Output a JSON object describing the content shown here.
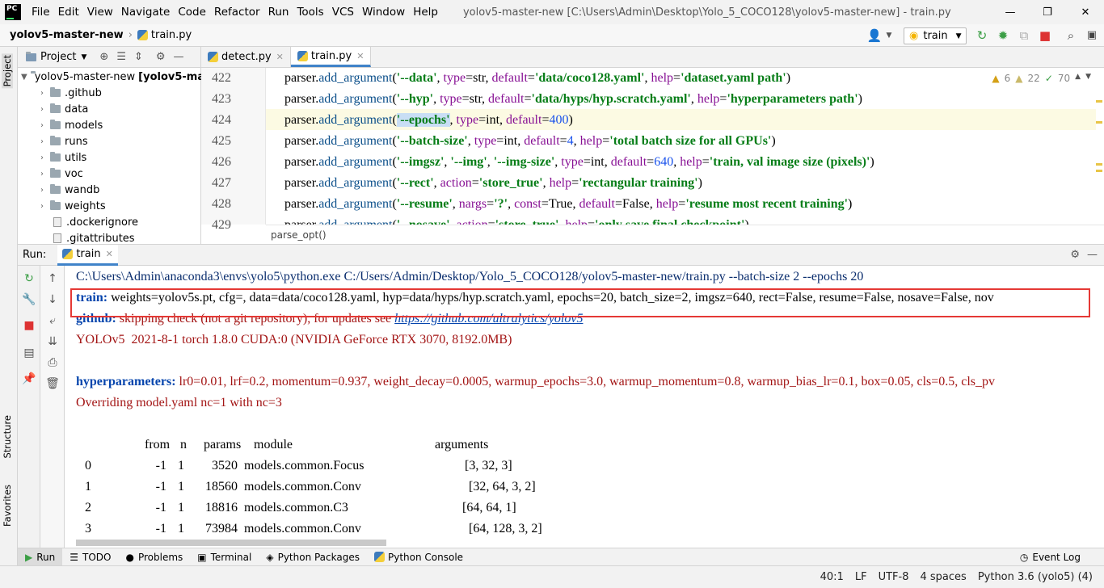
{
  "menu": [
    "File",
    "Edit",
    "View",
    "Navigate",
    "Code",
    "Refactor",
    "Run",
    "Tools",
    "VCS",
    "Window",
    "Help"
  ],
  "window_title": "yolov5-master-new [C:\\Users\\Admin\\Desktop\\Yolo_5_COCO128\\yolov5-master-new] - train.py",
  "app_logo": "PC",
  "navbar": {
    "project": "yolov5-master-new",
    "file": "train.py"
  },
  "run_config": "train",
  "sidebar_left": {
    "project": "Project",
    "structure": "Structure",
    "favorites": "Favorites"
  },
  "project_pane": {
    "title": "Project",
    "root": "yolov5-master-new",
    "root_suffix": "[yolov5-ma",
    "items": [
      {
        "label": ".github",
        "type": "folder"
      },
      {
        "label": "data",
        "type": "folder"
      },
      {
        "label": "models",
        "type": "folder"
      },
      {
        "label": "runs",
        "type": "folder"
      },
      {
        "label": "utils",
        "type": "folder"
      },
      {
        "label": "voc",
        "type": "folder"
      },
      {
        "label": "wandb",
        "type": "folder"
      },
      {
        "label": "weights",
        "type": "folder"
      },
      {
        "label": ".dockerignore",
        "type": "file"
      },
      {
        "label": ".gitattributes",
        "type": "file"
      }
    ]
  },
  "editor": {
    "tabs": [
      "detect.py",
      "train.py"
    ],
    "inspections": {
      "warnings": "6",
      "weak": "22",
      "typos": "70"
    },
    "breadcrumb": "parse_opt()",
    "line_numbers": [
      "422",
      "423",
      "424",
      "425",
      "426",
      "427",
      "428",
      "429"
    ],
    "lines": [
      [
        [
          "parser.",
          "n"
        ],
        [
          "add_argument",
          "fn"
        ],
        [
          "(",
          "n"
        ],
        [
          "'--data'",
          "s"
        ],
        [
          ", ",
          "n"
        ],
        [
          "type",
          "kw"
        ],
        [
          "=str, ",
          "n"
        ],
        [
          "default",
          "kw"
        ],
        [
          "=",
          "n"
        ],
        [
          "'data/coco128.yaml'",
          "s"
        ],
        [
          ", ",
          "n"
        ],
        [
          "help",
          "kw"
        ],
        [
          "=",
          "n"
        ],
        [
          "'dataset.yaml path'",
          "s"
        ],
        [
          ")",
          "n"
        ]
      ],
      [
        [
          "parser.",
          "n"
        ],
        [
          "add_argument",
          "fn"
        ],
        [
          "(",
          "n"
        ],
        [
          "'--hyp'",
          "s"
        ],
        [
          ", ",
          "n"
        ],
        [
          "type",
          "kw"
        ],
        [
          "=str, ",
          "n"
        ],
        [
          "default",
          "kw"
        ],
        [
          "=",
          "n"
        ],
        [
          "'data/hyps/hyp.scratch.yaml'",
          "s"
        ],
        [
          ", ",
          "n"
        ],
        [
          "help",
          "kw"
        ],
        [
          "=",
          "n"
        ],
        [
          "'hyperparameters path'",
          "s"
        ],
        [
          ")",
          "n"
        ]
      ],
      [
        [
          "parser.",
          "n"
        ],
        [
          "add_argument",
          "fn"
        ],
        [
          "(",
          "n"
        ],
        [
          "'--epochs'",
          "s"
        ],
        [
          ", ",
          "n"
        ],
        [
          "type",
          "kw"
        ],
        [
          "=int, ",
          "n"
        ],
        [
          "default",
          "kw"
        ],
        [
          "=",
          "n"
        ],
        [
          "400",
          "num"
        ],
        [
          ")",
          "n"
        ]
      ],
      [
        [
          "parser.",
          "n"
        ],
        [
          "add_argument",
          "fn"
        ],
        [
          "(",
          "n"
        ],
        [
          "'--batch-size'",
          "s"
        ],
        [
          ", ",
          "n"
        ],
        [
          "type",
          "kw"
        ],
        [
          "=int, ",
          "n"
        ],
        [
          "default",
          "kw"
        ],
        [
          "=",
          "n"
        ],
        [
          "4",
          "num"
        ],
        [
          ", ",
          "n"
        ],
        [
          "help",
          "kw"
        ],
        [
          "=",
          "n"
        ],
        [
          "'total batch size for all GPUs'",
          "s"
        ],
        [
          ")",
          "n"
        ]
      ],
      [
        [
          "parser.",
          "n"
        ],
        [
          "add_argument",
          "fn"
        ],
        [
          "(",
          "n"
        ],
        [
          "'--imgsz'",
          "s"
        ],
        [
          ", ",
          "n"
        ],
        [
          "'--img'",
          "s"
        ],
        [
          ", ",
          "n"
        ],
        [
          "'--img-size'",
          "s"
        ],
        [
          ", ",
          "n"
        ],
        [
          "type",
          "kw"
        ],
        [
          "=int, ",
          "n"
        ],
        [
          "default",
          "kw"
        ],
        [
          "=",
          "n"
        ],
        [
          "640",
          "num"
        ],
        [
          ", ",
          "n"
        ],
        [
          "help",
          "kw"
        ],
        [
          "=",
          "n"
        ],
        [
          "'train, val image size (pixels)'",
          "s"
        ],
        [
          ")",
          "n"
        ]
      ],
      [
        [
          "parser.",
          "n"
        ],
        [
          "add_argument",
          "fn"
        ],
        [
          "(",
          "n"
        ],
        [
          "'--rect'",
          "s"
        ],
        [
          ", ",
          "n"
        ],
        [
          "action",
          "kw"
        ],
        [
          "=",
          "n"
        ],
        [
          "'store_true'",
          "s"
        ],
        [
          ", ",
          "n"
        ],
        [
          "help",
          "kw"
        ],
        [
          "=",
          "n"
        ],
        [
          "'rectangular training'",
          "s"
        ],
        [
          ")",
          "n"
        ]
      ],
      [
        [
          "parser.",
          "n"
        ],
        [
          "add_argument",
          "fn"
        ],
        [
          "(",
          "n"
        ],
        [
          "'--resume'",
          "s"
        ],
        [
          ", ",
          "n"
        ],
        [
          "nargs",
          "kw"
        ],
        [
          "=",
          "n"
        ],
        [
          "'?'",
          "s"
        ],
        [
          ", ",
          "n"
        ],
        [
          "const",
          "kw"
        ],
        [
          "=True, ",
          "n"
        ],
        [
          "default",
          "kw"
        ],
        [
          "=False, ",
          "n"
        ],
        [
          "help",
          "kw"
        ],
        [
          "=",
          "n"
        ],
        [
          "'resume most recent training'",
          "s"
        ],
        [
          ")",
          "n"
        ]
      ],
      [
        [
          "parser.",
          "n"
        ],
        [
          "add_argument",
          "fn"
        ],
        [
          "(",
          "n"
        ],
        [
          "'--nosave'",
          "s"
        ],
        [
          ", ",
          "n"
        ],
        [
          "action",
          "kw"
        ],
        [
          "=",
          "n"
        ],
        [
          "'store_true'",
          "s"
        ],
        [
          ", ",
          "n"
        ],
        [
          "help",
          "kw"
        ],
        [
          "=",
          "n"
        ],
        [
          "'only save final checkpoint'",
          "s"
        ],
        [
          ")",
          "n"
        ]
      ]
    ]
  },
  "run": {
    "label": "Run:",
    "tab": "train",
    "command": "C:\\Users\\Admin\\anaconda3\\envs\\yolo5\\python.exe C:/Users/Admin/Desktop/Yolo_5_COCO128/yolov5-master-new/train.py --batch-size 2 --epochs 20",
    "train_label": "train:",
    "train_args": " weights=yolov5s.pt, cfg=, data=data/coco128.yaml, hyp=data/hyps/hyp.scratch.yaml, epochs=20, batch_size=2, imgsz=640, rect=False, resume=False, nosave=False, nov",
    "github_label": "github:",
    "github_text": " skipping check (not a git repository), for updates see ",
    "github_link": "https://github.com/ultralytics/yolov5",
    "yolo_line": "YOLOv5  2021-8-1 torch 1.8.0 CUDA:0 (NVIDIA GeForce RTX 3070, 8192.0MB)",
    "hyp_label": "hyperparameters:",
    "hyp_text": " lr0=0.01, lrf=0.2, momentum=0.937, weight_decay=0.0005, warmup_epochs=3.0, warmup_momentum=0.8, warmup_bias_lr=0.1, box=0.05, cls=0.5, cls_pv",
    "override": "Overriding model.yaml nc=1 with nc=3",
    "table_headers": [
      "from",
      "n",
      "params",
      "module",
      "arguments"
    ],
    "table_rows": [
      [
        "0",
        "-1",
        "1",
        "3520",
        "models.common.Focus",
        "[3, 32, 3]"
      ],
      [
        "1",
        "-1",
        "1",
        "18560",
        "models.common.Conv",
        "[32, 64, 3, 2]"
      ],
      [
        "2",
        "-1",
        "1",
        "18816",
        "models.common.C3",
        "[64, 64, 1]"
      ],
      [
        "3",
        "-1",
        "1",
        "73984",
        "models.common.Conv",
        "[64, 128, 3, 2]"
      ]
    ]
  },
  "bottom_tabs": [
    "Run",
    "TODO",
    "Problems",
    "Terminal",
    "Python Packages",
    "Python Console",
    "Event Log"
  ],
  "status": {
    "position": "40:1",
    "line_sep": "LF",
    "encoding": "UTF-8",
    "indent": "4 spaces",
    "interpreter": "Python 3.6 (yolo5) (4)"
  }
}
